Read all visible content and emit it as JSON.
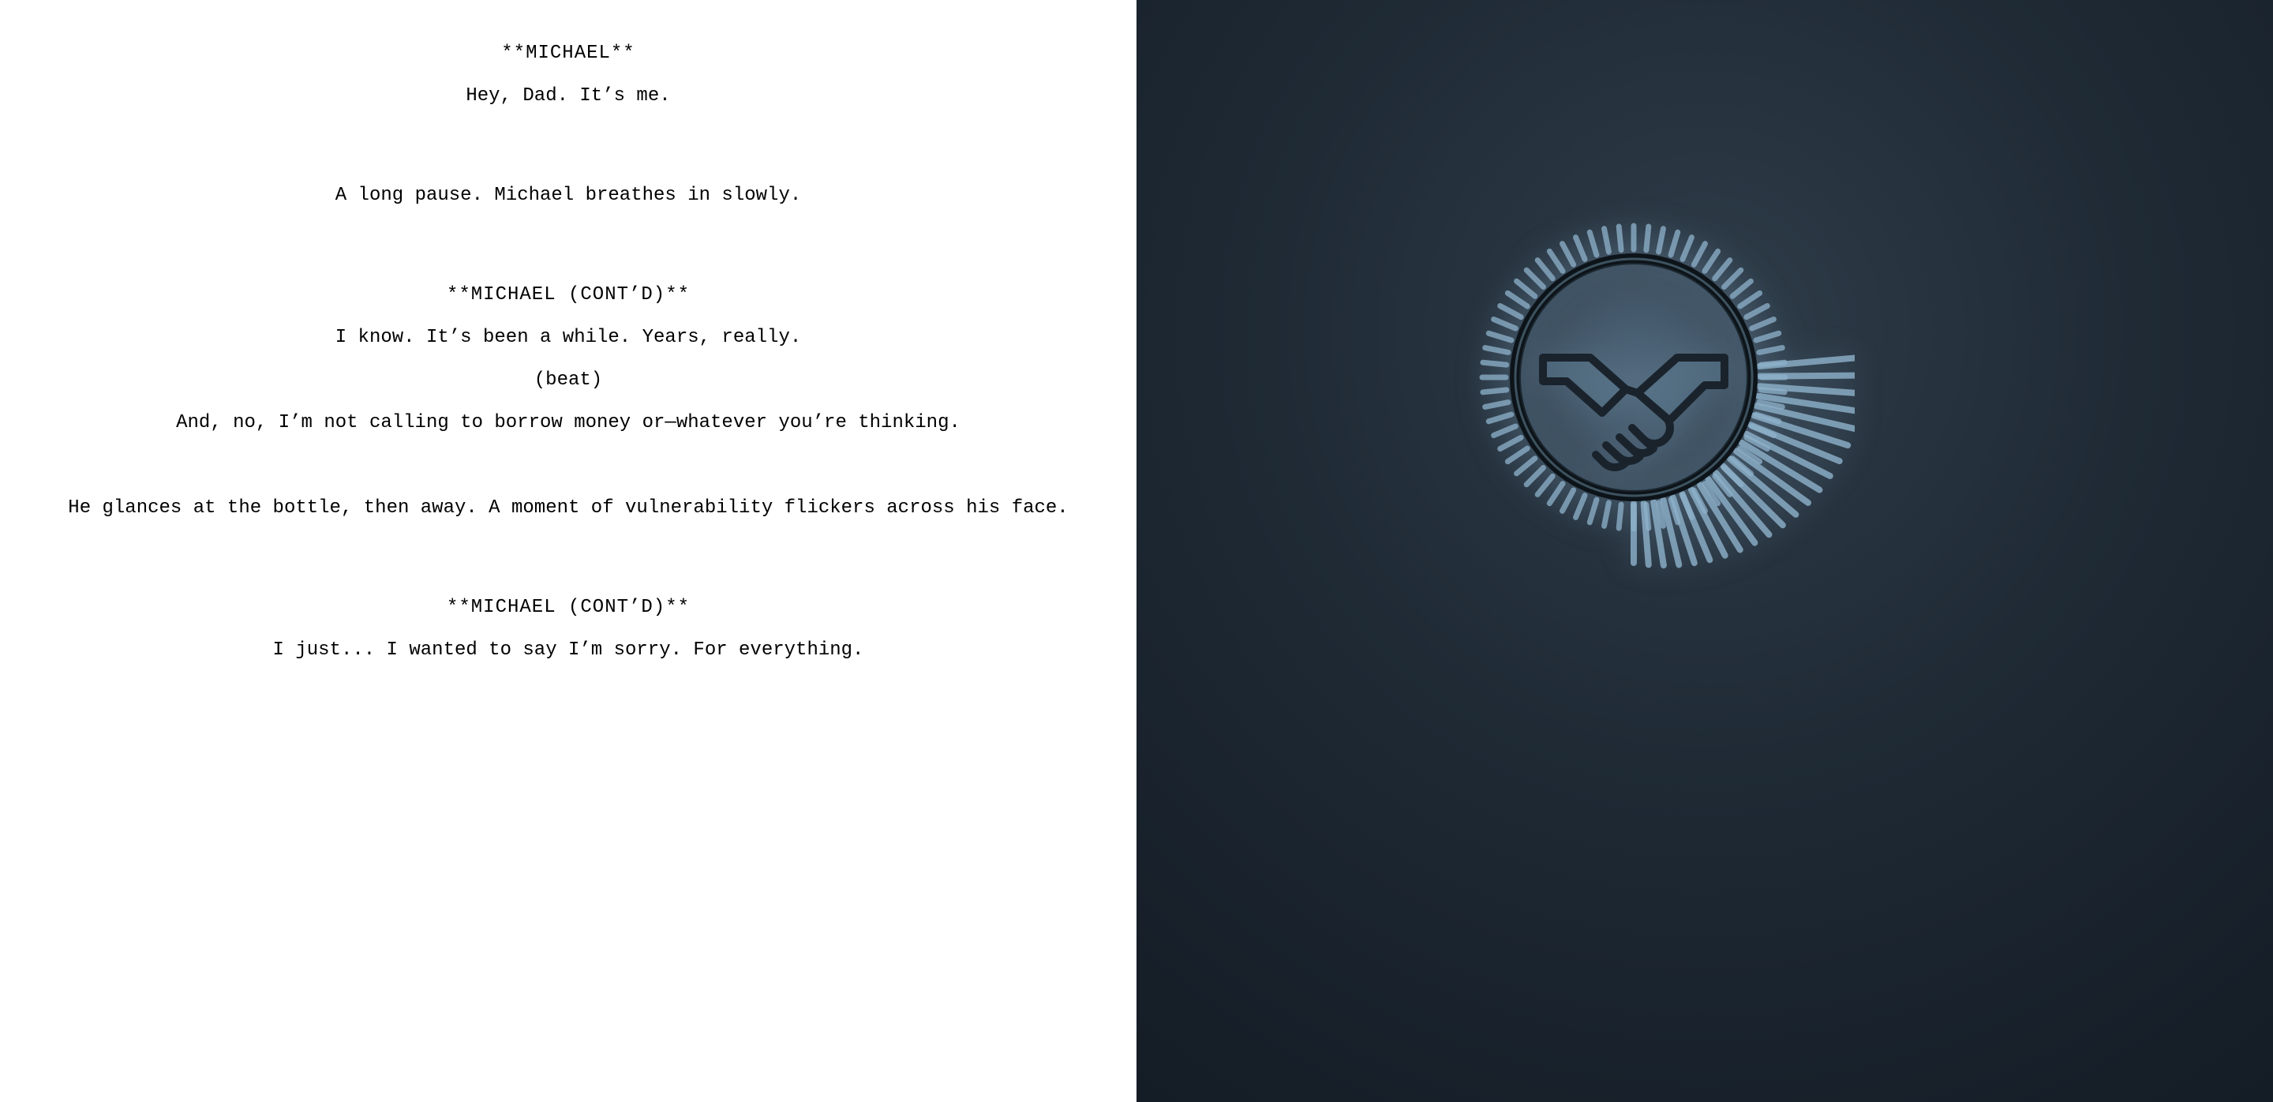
{
  "screenplay": {
    "cue1_speaker": "**MICHAEL**",
    "cue1_line": "Hey, Dad. It’s me.",
    "action1": "A long pause. Michael breathes in slowly.",
    "cue2_speaker": "**MICHAEL (CONT’D)**",
    "cue2_line1": "I know. It’s been a while. Years, really.",
    "cue2_paren": "(beat)",
    "cue2_line2": "And, no, I’m not calling to borrow money or—whatever you’re thinking.",
    "action2": "He glances at the bottle, then away. A moment of vulnerability flickers across his face.",
    "cue3_speaker": "**MICHAEL (CONT’D)**",
    "cue3_line": "I just... I wanted to say I’m sorry. For everything."
  },
  "emblem": {
    "name": "handshake-emblem"
  }
}
